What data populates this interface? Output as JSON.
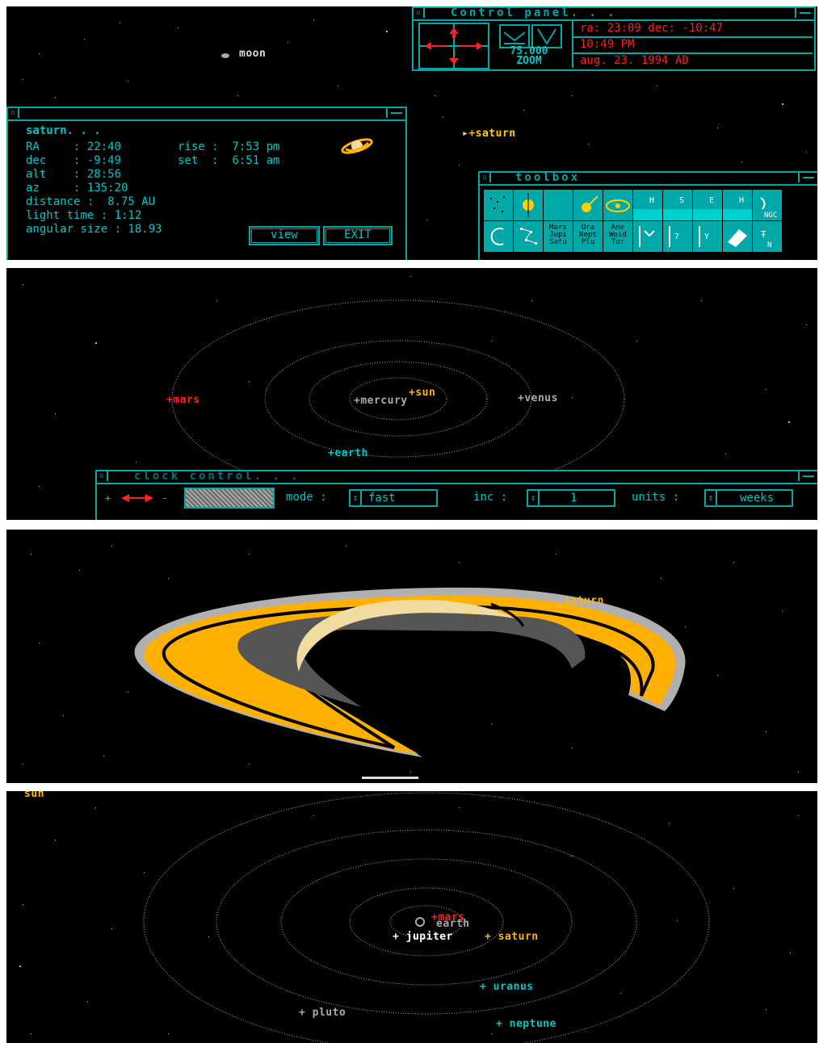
{
  "panel1": {
    "labels": {
      "moon": "moon",
      "saturn": "saturn"
    },
    "control_panel": {
      "title": "Control panel. . .",
      "zoom_value": "75.000",
      "zoom_label": "ZOOM",
      "ra_dec": "ra: 23:09 dec: -10:47",
      "time": "10:49 PM",
      "date": "aug. 23. 1994 AD"
    },
    "info_window": {
      "name": "saturn. . .",
      "ra": "RA     : 22:40",
      "dec": "dec    : -9:49",
      "alt": "alt    : 28:56",
      "az": "az     : 135:20",
      "rise": "rise :  7:53 pm",
      "set": "set  :  6:51 am",
      "distance": "distance :  8.75 AU",
      "light_time": "light time : 1:12",
      "angular_size": "angular size : 18.93",
      "view_label": "view",
      "exit_label": "EXIT"
    },
    "toolbox": {
      "title": "toolbox",
      "row2_tools": [
        {
          "label": ""
        },
        {
          "label": ""
        },
        {
          "label": "Mars Jupi Satu"
        },
        {
          "label": "Ura Nept Plu"
        },
        {
          "label": "Ane Woid Tor"
        },
        {
          "label": ""
        },
        {
          "label": ""
        },
        {
          "label": ""
        },
        {
          "label": ""
        },
        {
          "label": ""
        }
      ],
      "ngc_label": "NGC"
    }
  },
  "panel2": {
    "labels": {
      "sun": "sun",
      "mercury": "mercury",
      "venus": "venus",
      "earth": "earth",
      "mars": "mars"
    },
    "clock_control": {
      "title": "clock control. . .",
      "mode_label": "mode :",
      "mode_value": "fast",
      "inc_label": "inc :",
      "inc_value": "1",
      "units_label": "units :",
      "units_value": "weeks"
    }
  },
  "panel3": {
    "labels": {
      "saturn": "saturn"
    }
  },
  "panel4": {
    "labels": {
      "sun": "sun",
      "mars": "mars",
      "earth": "earth",
      "jupiter": "jupiter",
      "saturn": "saturn",
      "uranus": "uranus",
      "neptune": "neptune",
      "pluto": "pluto"
    }
  },
  "colors": {
    "cyan": "#00a8a8",
    "cyan_light": "#00c8c8",
    "red": "#ff2020",
    "yellow": "#ffb400",
    "gray": "#aaaaaa",
    "ring_gold": "#ffb000",
    "ring_gray": "#555555",
    "ring_light": "#f0dca0"
  },
  "icons": [
    "up-arrow-icon",
    "down-arrow-icon",
    "left-arrow-icon",
    "right-arrow-icon",
    "zoom-out-icon",
    "zoom-in-icon",
    "saturn-icon",
    "sun-icon",
    "moon-icon",
    "comet-icon",
    "eraser-icon",
    "constellation-icon"
  ]
}
